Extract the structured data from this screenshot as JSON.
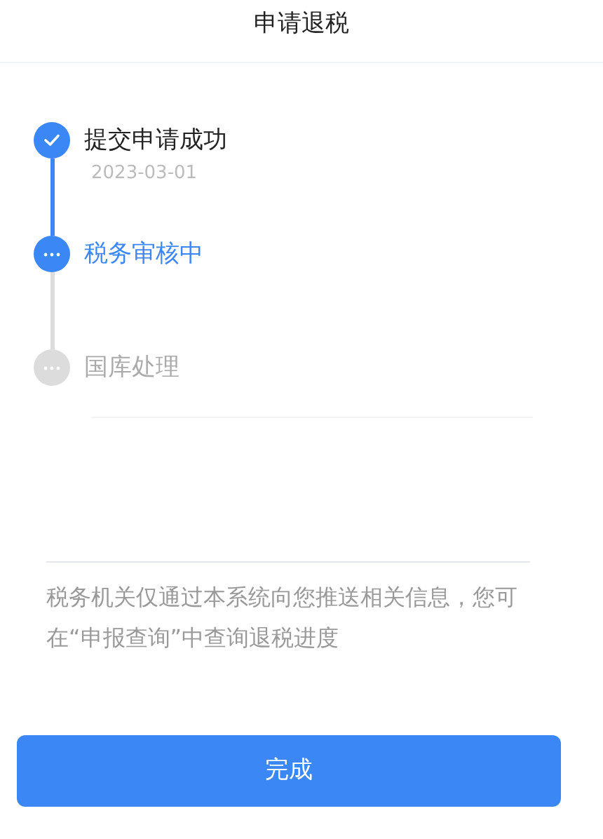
{
  "header": {
    "title": "申请退税"
  },
  "steps": [
    {
      "title": "提交申请成功",
      "date": "2023-03-01",
      "kind": "done"
    },
    {
      "title": "税务审核中",
      "kind": "active"
    },
    {
      "title": "国库处理",
      "kind": "pending"
    }
  ],
  "notice": "税务机关仅通过本系统向您推送相关信息，您可在“申报查询”中查询退税进度",
  "button": "完成"
}
